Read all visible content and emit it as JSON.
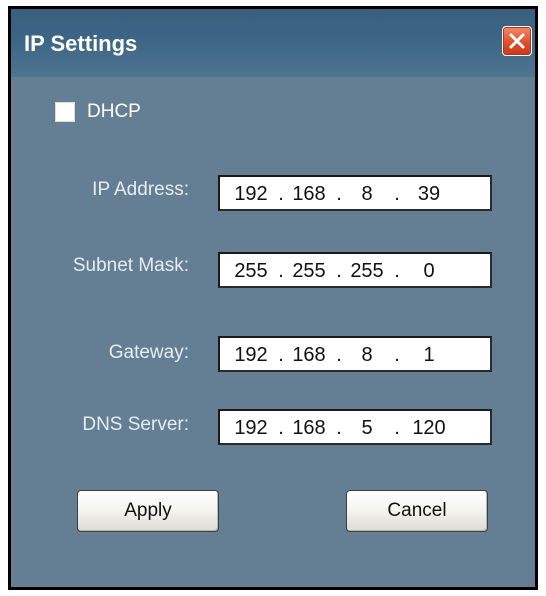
{
  "window": {
    "title": "IP Settings",
    "close_icon": "close-icon"
  },
  "dhcp": {
    "label": "DHCP",
    "checked": false
  },
  "fields": {
    "ip_address": {
      "label": "IP Address:",
      "octets": [
        "192",
        "168",
        "8",
        "39"
      ]
    },
    "subnet_mask": {
      "label": "Subnet Mask:",
      "octets": [
        "255",
        "255",
        "255",
        "0"
      ]
    },
    "gateway": {
      "label": "Gateway:",
      "octets": [
        "192",
        "168",
        "8",
        "1"
      ]
    },
    "dns_server": {
      "label": "DNS Server:",
      "octets": [
        "192",
        "168",
        "5",
        "120"
      ]
    }
  },
  "separator": ".",
  "buttons": {
    "apply_label": "Apply",
    "cancel_label": "Cancel"
  },
  "colors": {
    "dialog_background": "#647f94",
    "titlebar": "#3d6585",
    "close_button": "#e0502c"
  }
}
